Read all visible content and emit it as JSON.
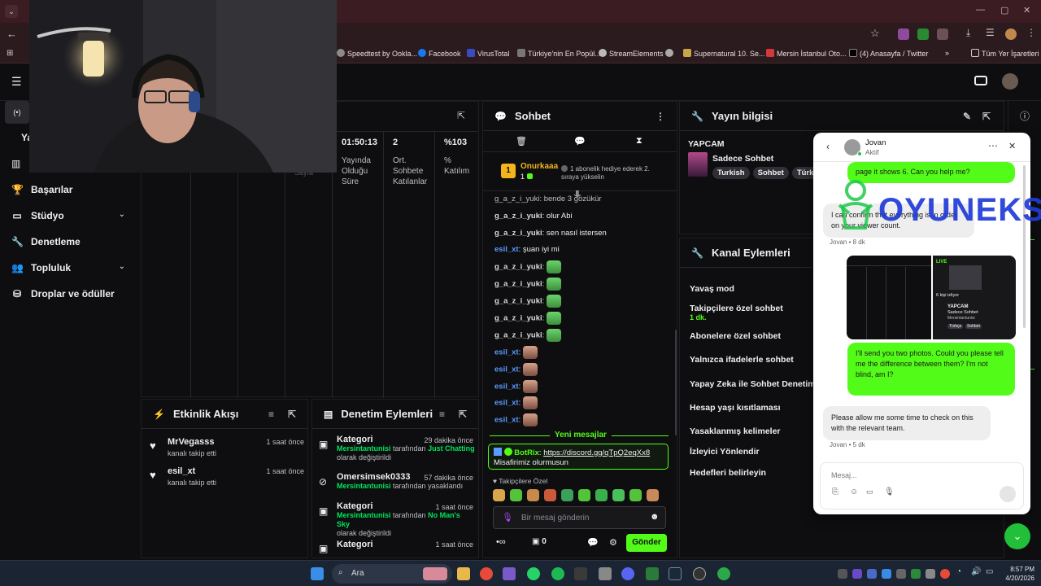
{
  "browser": {
    "bookmarks": [
      "Speedtest by Ookla...",
      "Facebook",
      "VirusTotal",
      "Türkiye'nin En Popül...",
      "StreamElements",
      "Supernatural 10. Se...",
      "Mersin İstanbul Oto...",
      "(4) Anasayfa / Twitter",
      "Tüm Yer İşaretleri"
    ]
  },
  "sidebar": {
    "items": [
      {
        "label": "Başarılar",
        "icon": "trophy-icon"
      },
      {
        "label": "Stüdyo",
        "icon": "studio-icon"
      },
      {
        "label": "Denetleme",
        "icon": "wrench-icon"
      },
      {
        "label": "Topluluk",
        "icon": "community-icon"
      },
      {
        "label": "Droplar ve ödüller",
        "icon": "drops-icon"
      }
    ],
    "partial_label": "Ya"
  },
  "stats": {
    "partial_label": "Sayfa",
    "items": [
      {
        "value": "01:50:13",
        "label": "Yayında Olduğu Süre"
      },
      {
        "value": "2",
        "label": "Ort. Sohbete Katılanlar"
      },
      {
        "value": "%103",
        "label": "% Katılım"
      }
    ]
  },
  "activity": {
    "title": "Etkinlik Akışı",
    "events": [
      {
        "name": "MrVegasss",
        "sub": "kanalı takip etti",
        "time": "1 saat önce"
      },
      {
        "name": "esil_xt",
        "sub": "kanalı takip etti",
        "time": "1 saat önce"
      }
    ]
  },
  "mod_actions": {
    "title": "Denetim Eylemleri",
    "items": [
      {
        "name": "Kategori",
        "time": "29 dakika önce",
        "actor": "Mersintantunisi",
        "text": "tarafından",
        "target": "Just Chatting",
        "tail": "olarak değiştirildi"
      },
      {
        "name": "Omersimsek0333",
        "time": "57 dakika önce",
        "actor": "Mersintantunisi",
        "text": "tarafından yasaklandı",
        "target": "",
        "tail": ""
      },
      {
        "name": "Kategori",
        "time": "1 saat önce",
        "actor": "Mersintantunisi",
        "text": "tarafından",
        "target": "No Man's Sky",
        "tail": "olarak değiştirildi"
      },
      {
        "name": "Kategori",
        "time": "1 saat önce"
      }
    ]
  },
  "chat": {
    "title": "Sohbet",
    "pinned_user": "Onurkaaa",
    "pinned_count": "1",
    "pinned_text": "1 abonelik hediye ederek 2. sıraya yükselin",
    "partial_line": "g_a_z_i_yuki: bende 3 gözükür",
    "lines": [
      {
        "user": "g_a_z_i_yuki",
        "text": "olur Abi"
      },
      {
        "user": "g_a_z_i_yuki",
        "text": "sen nasıl istersen"
      },
      {
        "user": "esil_xt",
        "text": "şuan iyi mi"
      }
    ],
    "emote_users": [
      "g_a_z_i_yuki",
      "g_a_z_i_yuki",
      "g_a_z_i_yuki",
      "g_a_z_i_yuki",
      "g_a_z_i_yuki",
      "esil_xt",
      "esil_xt",
      "esil_xt",
      "esil_xt",
      "esil_xt"
    ],
    "new_messages": "Yeni mesajlar",
    "bot_name": "BotRix",
    "bot_link": "https://discord.gg/qTpQ2eqXx8",
    "bot_text": "Misafirimiz olurmusun",
    "followers_only": "Takipçilere Özel",
    "input_placeholder": "Bir mesaj gönderin",
    "points": "0",
    "send": "Gönder"
  },
  "stream_info": {
    "title": "Yayın bilgisi",
    "stream_title": "YAPCAM",
    "category": "Sadece Sohbet",
    "tags": [
      "Turkish",
      "Sohbet",
      "Türkçe"
    ]
  },
  "channel_actions": {
    "title": "Kanal Eylemleri",
    "items": [
      "Yavaş mod",
      "Takipçilere özel sohbet",
      "Abonelere özel sohbet",
      "Yalnızca ifadelerle sohbet",
      "Yapay Zeka ile Sohbet Denetimi",
      "Hesap yaşı kısıtlaması",
      "Yasaklanmış kelimeler",
      "İzleyici Yönlendir",
      "Hedefleri belirleyin"
    ],
    "follower_duration": "1 dk."
  },
  "dm": {
    "name": "Jovan",
    "status": "Aktif",
    "msg1_partial": "page it shows 6. Can you help me?",
    "msg2": "I can confirm that everything is in order on your viewer count.",
    "msg2_meta": "Jovan • 8 dk",
    "photo_caption1": "YAPCAM",
    "photo_caption2": "Sadece Sohbet",
    "photo_caption3": "Mersintantunisi",
    "photo_viewers": "6 kişi izliyor",
    "photo_live": "LIVE",
    "photo_tags": [
      "Türkçe",
      "Sohbet"
    ],
    "msg3": "I'll send you two photos. Could you please tell me the difference between them? I'm not blind, am I?",
    "msg4": "Please allow me some time to check on this with the relevant team.",
    "msg4_meta": "Jovan • 5 dk",
    "input_placeholder": "Mesaj..."
  },
  "watermark": "OYUNEKS",
  "taskbar": {
    "search": "Ara",
    "time": "8:57 PM",
    "date": "4/20/2026"
  },
  "colors": {
    "accent": "#53fc18",
    "bg": "#0e0e10",
    "chrome": "#2b1a1e"
  }
}
